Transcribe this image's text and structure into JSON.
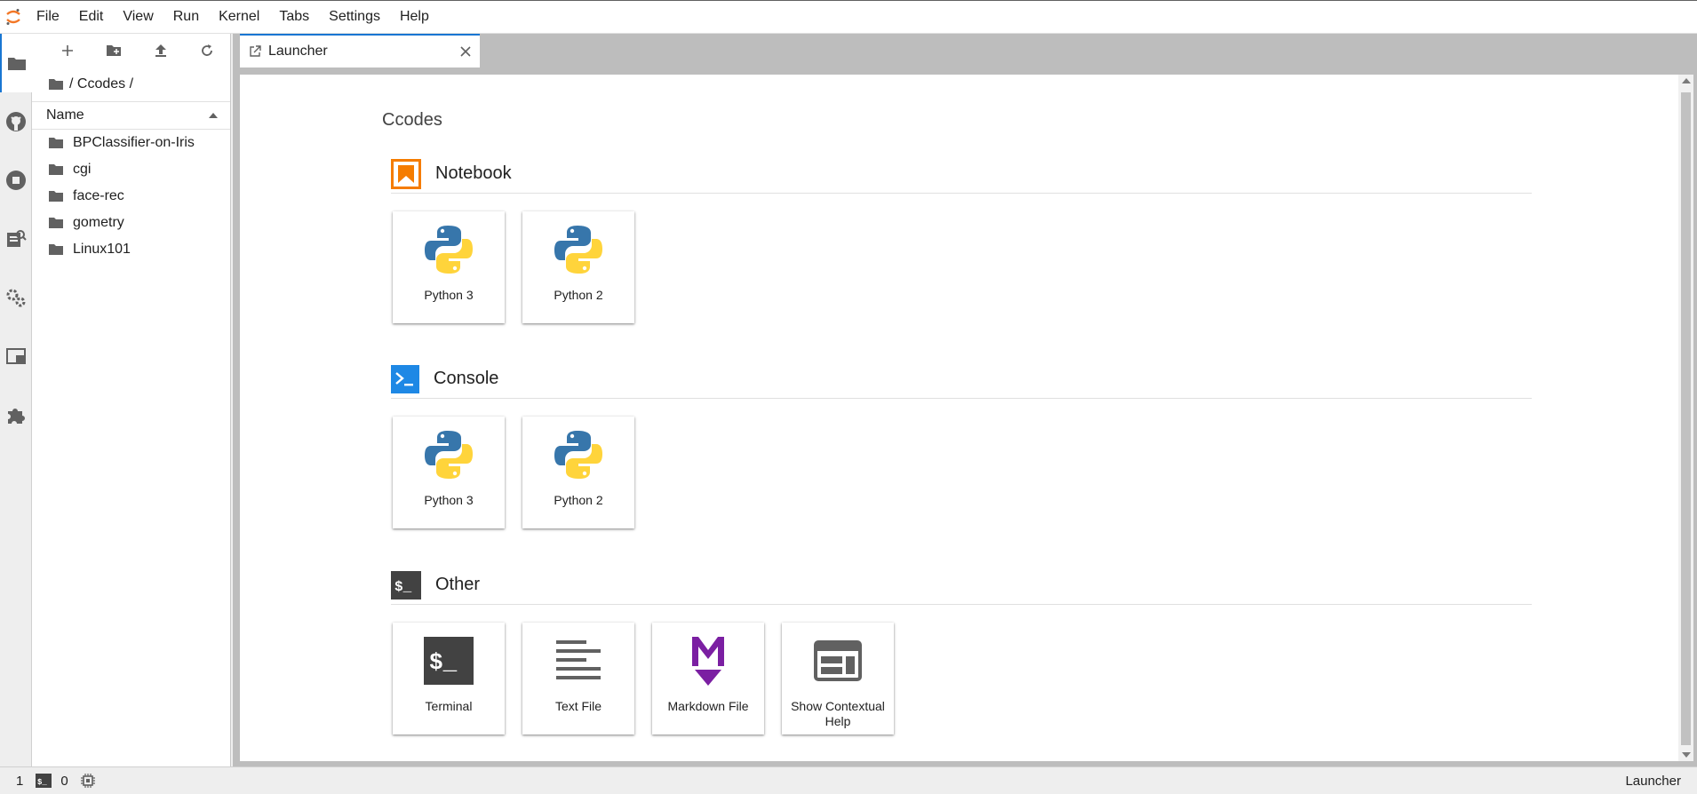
{
  "menubar": {
    "logo_icon": "jupyter-logo-icon",
    "items": [
      "File",
      "Edit",
      "View",
      "Run",
      "Kernel",
      "Tabs",
      "Settings",
      "Help"
    ]
  },
  "activity_bar": {
    "icons": [
      "folder-icon",
      "github-icon",
      "running-stop-icon",
      "command-palette-icon",
      "property-inspector-icon",
      "tabs-icon",
      "extension-icon"
    ]
  },
  "filebrowser": {
    "toolbar_icons": [
      "new-launcher-icon",
      "new-folder-icon",
      "upload-icon",
      "refresh-icon"
    ],
    "breadcrumb": "/ Ccodes /",
    "header": "Name",
    "items": [
      "BPClassifier-on-Iris",
      "cgi",
      "face-rec",
      "gometry",
      "Linux101"
    ]
  },
  "tab": {
    "label": "Launcher"
  },
  "launcher": {
    "title": "Ccodes",
    "sections": [
      {
        "title": "Notebook",
        "icon": "notebook-icon",
        "color": "#F57C00",
        "cards": [
          "Python 3",
          "Python 2"
        ]
      },
      {
        "title": "Console",
        "icon": "console-icon",
        "color": "#1E88E5",
        "cards": [
          "Python 3",
          "Python 2"
        ]
      },
      {
        "title": "Other",
        "icon": "terminal-icon",
        "color": "#424242",
        "cards": [
          "Terminal",
          "Text File",
          "Markdown File",
          "Show Contextual Help"
        ]
      }
    ]
  },
  "statusbar": {
    "kernel_count": "1",
    "terminal_count": "0",
    "right_label": "Launcher"
  }
}
